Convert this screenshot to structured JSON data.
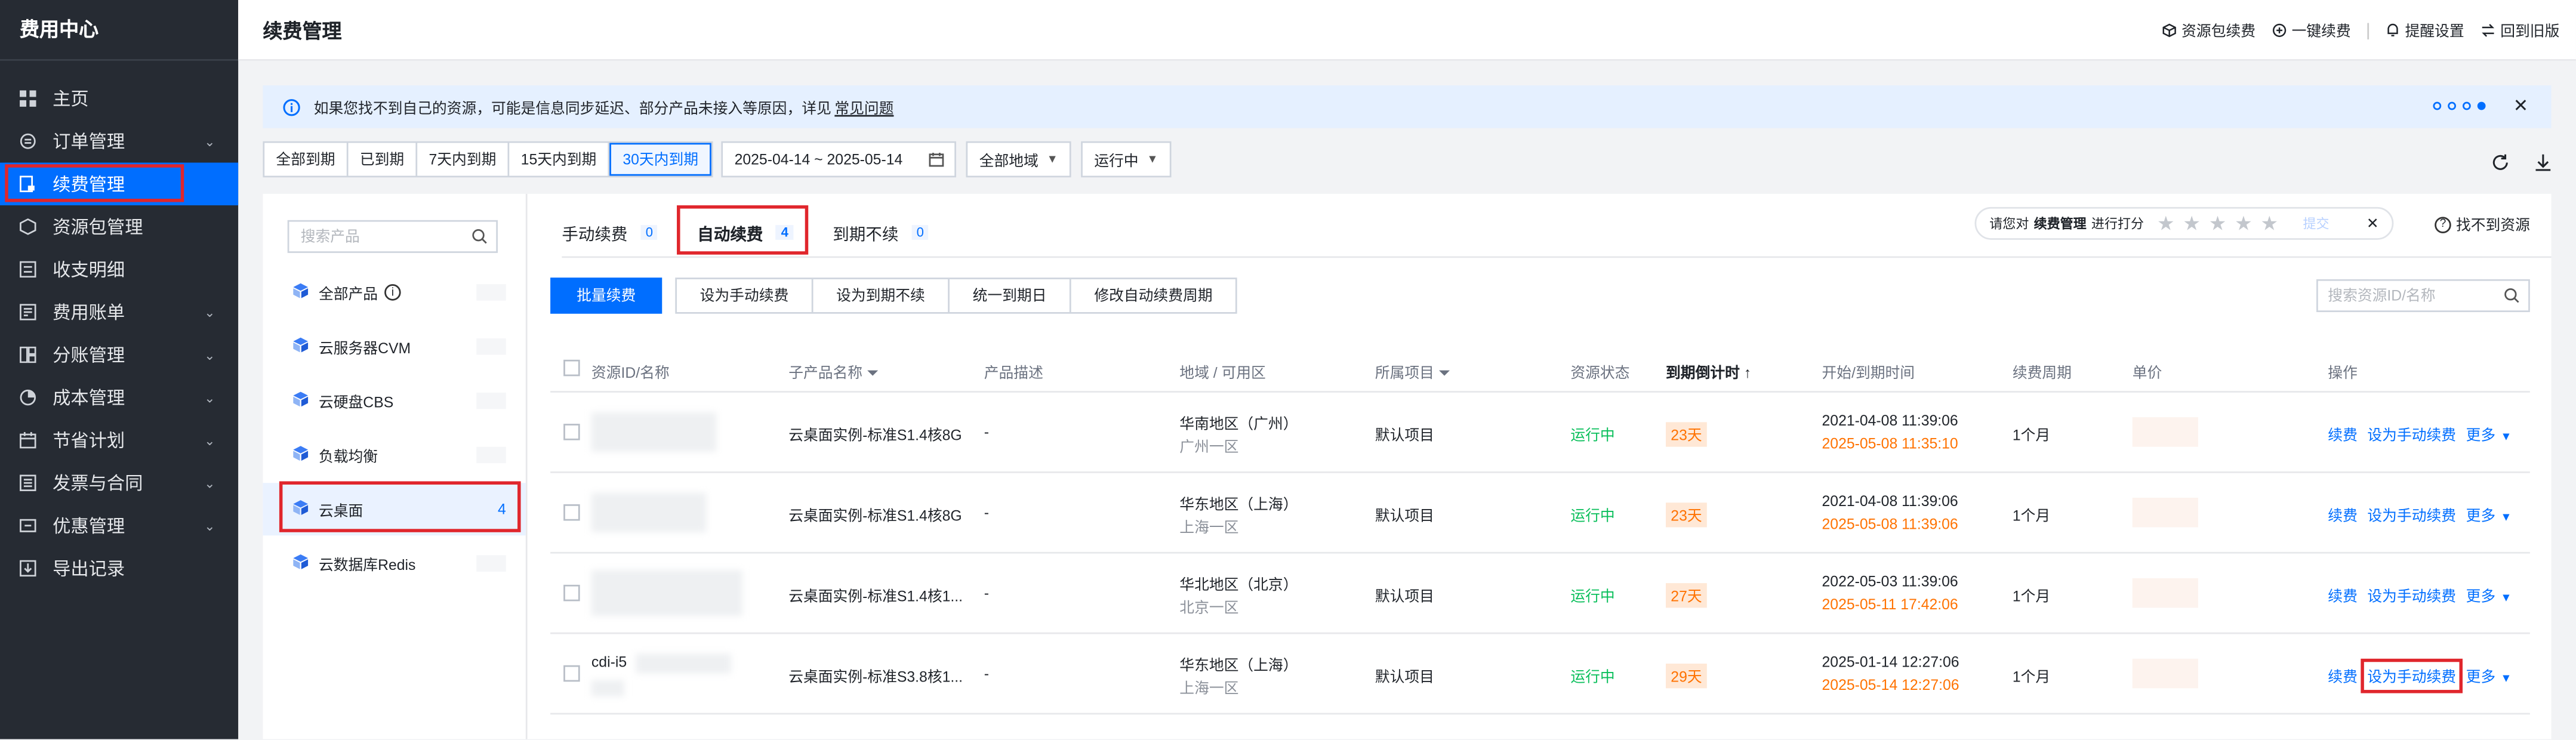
{
  "sidebar": {
    "title": "费用中心",
    "items": [
      {
        "label": "主页",
        "icon": "grid-icon",
        "expand": false,
        "active": false
      },
      {
        "label": "订单管理",
        "icon": "order-icon",
        "expand": true,
        "active": false
      },
      {
        "label": "续费管理",
        "icon": "renew-icon",
        "expand": false,
        "active": true
      },
      {
        "label": "资源包管理",
        "icon": "package-icon",
        "expand": false,
        "active": false
      },
      {
        "label": "收支明细",
        "icon": "list-icon",
        "expand": false,
        "active": false
      },
      {
        "label": "费用账单",
        "icon": "bill-icon",
        "expand": true,
        "active": false
      },
      {
        "label": "分账管理",
        "icon": "split-icon",
        "expand": true,
        "active": false
      },
      {
        "label": "成本管理",
        "icon": "pie-icon",
        "expand": true,
        "active": false
      },
      {
        "label": "节省计划",
        "icon": "calendar-icon",
        "expand": true,
        "active": false
      },
      {
        "label": "发票与合同",
        "icon": "invoice-icon",
        "expand": true,
        "active": false
      },
      {
        "label": "优惠管理",
        "icon": "coupon-icon",
        "expand": true,
        "active": false
      },
      {
        "label": "导出记录",
        "icon": "export-icon",
        "expand": false,
        "active": false
      }
    ]
  },
  "header": {
    "title": "续费管理",
    "actions": [
      {
        "label": "资源包续费",
        "icon": "cube-icon"
      },
      {
        "label": "一键续费",
        "icon": "renew-circle-icon"
      },
      {
        "label": "提醒设置",
        "icon": "bell-icon"
      },
      {
        "label": "回到旧版",
        "icon": "switch-icon"
      }
    ]
  },
  "notice": {
    "text": "如果您找不到自己的资源，可能是信息同步延迟、部分产品未接入等原因，详见",
    "link": "常见问题",
    "close": "✕"
  },
  "filters": {
    "periods": [
      "全部到期",
      "已到期",
      "7天内到期",
      "15天内到期",
      "30天内到期"
    ],
    "active_period": 4,
    "date_range": "2025-04-14  ~ 2025-05-14",
    "region": "全部地域",
    "status": "运行中"
  },
  "categories": {
    "search_placeholder": "搜索产品",
    "items": [
      {
        "label": "全部产品",
        "info": "i",
        "count": ""
      },
      {
        "label": "云服务器CVM",
        "count": ""
      },
      {
        "label": "云硬盘CBS",
        "count": ""
      },
      {
        "label": "负载均衡",
        "count": ""
      },
      {
        "label": "云桌面",
        "count": "4",
        "active": true
      },
      {
        "label": "云数据库Redis",
        "count": ""
      }
    ]
  },
  "tabs": [
    {
      "label": "手动续费",
      "count": "0"
    },
    {
      "label": "自动续费",
      "count": "4",
      "active": true
    },
    {
      "label": "到期不续",
      "count": "0"
    }
  ],
  "rating": {
    "prefix": "请您对",
    "target": "续费管理",
    "suffix": "进行打分",
    "stars": "★★★★★",
    "submit": "提交",
    "close": "✕"
  },
  "help": "找不到资源",
  "help_icon": "?",
  "toolbar": {
    "primary": "批量续费",
    "buttons": [
      "设为手动续费",
      "设为到期不续",
      "统一到期日",
      "修改自动续费周期"
    ],
    "search_placeholder": "搜索资源ID/名称"
  },
  "table": {
    "headers": {
      "id": "资源ID/名称",
      "product": "子产品名称",
      "desc": "产品描述",
      "region": "地域 / 可用区",
      "project": "所属项目",
      "status": "资源状态",
      "countdown": "到期倒计时",
      "time": "开始/到期时间",
      "cycle": "续费周期",
      "price": "单价",
      "ops": "操作"
    },
    "rows": [
      {
        "id": "",
        "product": "云桌面实例-标准S1.4核8G",
        "desc": "-",
        "region": "华南地区（广州）",
        "zone": "广州一区",
        "project": "默认项目",
        "status": "运行中",
        "days": "23天",
        "start": "2021-04-08 11:39:06",
        "end": "2025-05-08 11:35:10",
        "cycle": "1个月",
        "op1": "续费",
        "op2": "设为手动续费",
        "op3": "更多"
      },
      {
        "id": "",
        "product": "云桌面实例-标准S1.4核8G",
        "desc": "-",
        "region": "华东地区（上海）",
        "zone": "上海一区",
        "project": "默认项目",
        "status": "运行中",
        "days": "23天",
        "start": "2021-04-08 11:39:06",
        "end": "2025-05-08 11:39:06",
        "cycle": "1个月",
        "op1": "续费",
        "op2": "设为手动续费",
        "op3": "更多"
      },
      {
        "id": "",
        "product": "云桌面实例-标准S1.4核1...",
        "desc": "-",
        "region": "华北地区（北京）",
        "zone": "北京一区",
        "project": "默认项目",
        "status": "运行中",
        "days": "27天",
        "start": "2022-05-03 11:39:06",
        "end": "2025-05-11 17:42:06",
        "cycle": "1个月",
        "op1": "续费",
        "op2": "设为手动续费",
        "op3": "更多"
      },
      {
        "id": "cdi-i5",
        "product": "云桌面实例-标准S3.8核1...",
        "desc": "-",
        "region": "华东地区（上海）",
        "zone": "上海一区",
        "project": "默认项目",
        "status": "运行中",
        "days": "29天",
        "start": "2025-01-14 12:27:06",
        "end": "2025-05-14 12:27:06",
        "cycle": "1个月",
        "op1": "续费",
        "op2": "设为手动续费",
        "op3": "更多",
        "highlight": true
      }
    ]
  },
  "colors": {
    "primary": "#006eff",
    "sidebar": "#262b33",
    "success": "#0abf5b",
    "warning": "#ff7200",
    "highlight": "#e0262c"
  }
}
